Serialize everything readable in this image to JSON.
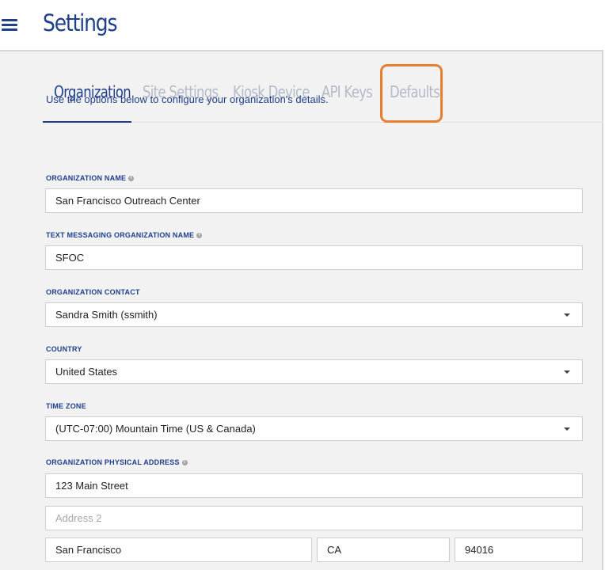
{
  "header": {
    "title": "Settings",
    "menu_icon": "hamburger-menu-icon"
  },
  "tabs": [
    {
      "label": "Organization",
      "active": true
    },
    {
      "label": "Site Settings",
      "active": false
    },
    {
      "label": "Kiosk Device",
      "active": false
    },
    {
      "label": "API Keys",
      "active": false
    },
    {
      "label": "Defaults",
      "active": false,
      "highlighted": true
    }
  ],
  "intro": "Use the options below to configure your organization's details.",
  "form": {
    "org_name": {
      "label": "ORGANIZATION NAME",
      "value": "San Francisco Outreach Center"
    },
    "sms_name": {
      "label": "TEXT MESSAGING ORGANIZATION NAME",
      "value": "SFOC"
    },
    "contact": {
      "label": "ORGANIZATION CONTACT",
      "value": "Sandra Smith (ssmith)"
    },
    "country": {
      "label": "COUNTRY",
      "value": "United States"
    },
    "timezone": {
      "label": "TIME ZONE",
      "value": "(UTC-07:00) Mountain Time (US & Canada)"
    },
    "address": {
      "label": "ORGANIZATION PHYSICAL ADDRESS",
      "line1": "123 Main Street",
      "line2_placeholder": "Address 2",
      "city": "San Francisco",
      "state": "CA",
      "zip": "94016"
    }
  },
  "colors": {
    "brand": "#1f3f8a",
    "inactive_tab": "#b3bac7",
    "highlight": "#e87e2e",
    "background": "#f2f2f2"
  }
}
